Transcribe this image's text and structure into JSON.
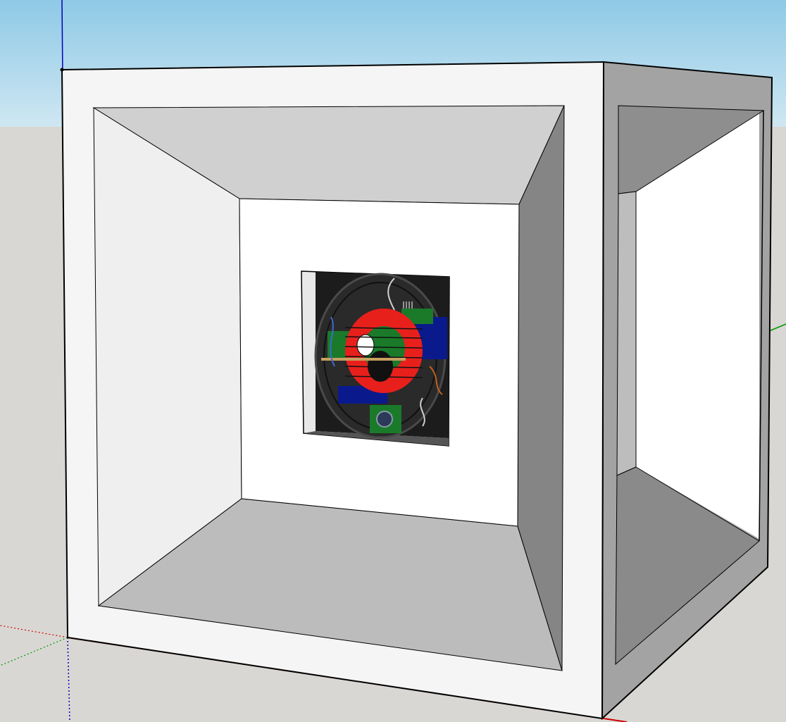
{
  "scene": {
    "sky_top": "#8ec9e6",
    "sky_bottom": "#cfe7f2",
    "ground": "#d9d7d3",
    "face_front": "#f5f5f5",
    "face_side": "#a3a3a3",
    "bevel_top": "#d0d0d0",
    "bevel_left": "#efefef",
    "bevel_bottom": "#bcbcbc",
    "bevel_right": "#858585",
    "back_wall": "#ffffff",
    "edge": "#000000"
  },
  "axes": {
    "red": "#cc0000",
    "green": "#009900",
    "blue": "#0000bb"
  },
  "texture": {
    "ring_color": "#e8201c",
    "board_color": "#1a7a2a",
    "dark_color": "#1c1c1c",
    "blue_color": "#0a1a8c"
  }
}
